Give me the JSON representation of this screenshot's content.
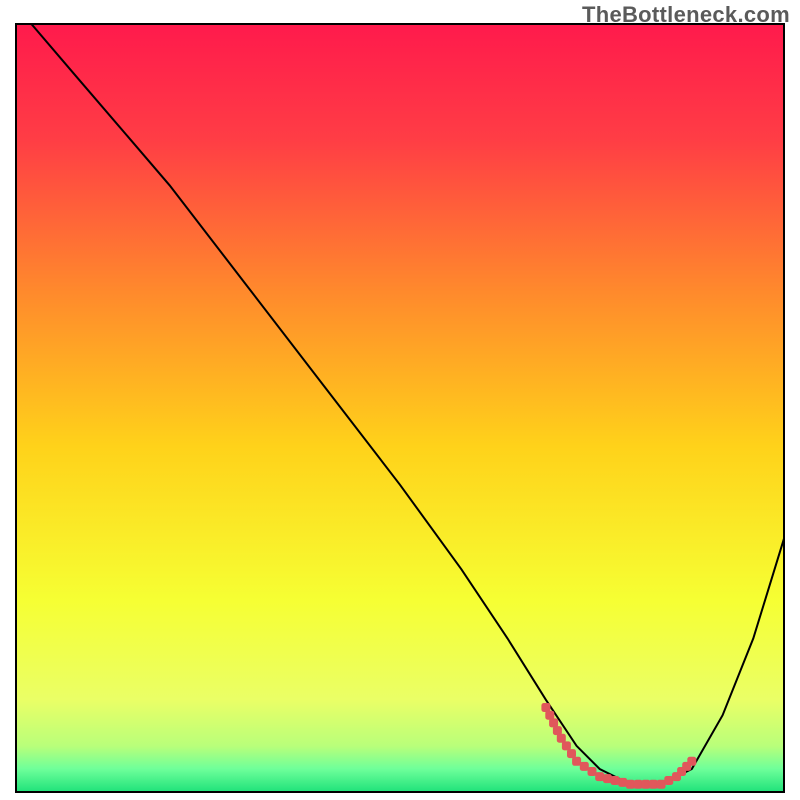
{
  "watermark": "TheBottleneck.com",
  "chart_data": {
    "type": "line",
    "title": "",
    "xlabel": "",
    "ylabel": "",
    "xlim": [
      0,
      100
    ],
    "ylim": [
      0,
      100
    ],
    "grid": false,
    "legend": false,
    "background_gradient": {
      "direction": "vertical",
      "stops": [
        {
          "pos": 0.0,
          "color": "#ff1a4c"
        },
        {
          "pos": 0.15,
          "color": "#ff3d45"
        },
        {
          "pos": 0.35,
          "color": "#ff8a2c"
        },
        {
          "pos": 0.55,
          "color": "#ffd21a"
        },
        {
          "pos": 0.75,
          "color": "#f6ff33"
        },
        {
          "pos": 0.88,
          "color": "#eaff66"
        },
        {
          "pos": 0.94,
          "color": "#b9ff7a"
        },
        {
          "pos": 0.97,
          "color": "#6eff9a"
        },
        {
          "pos": 1.0,
          "color": "#1fe27a"
        }
      ]
    },
    "series": [
      {
        "name": "bottleneck-curve",
        "color": "#000000",
        "x": [
          2,
          8,
          14,
          20,
          30,
          40,
          50,
          58,
          64,
          69,
          73,
          76,
          80,
          84,
          88,
          92,
          96,
          100
        ],
        "y": [
          100,
          93,
          86,
          79,
          66,
          53,
          40,
          29,
          20,
          12,
          6,
          3,
          1,
          1,
          3,
          10,
          20,
          33
        ]
      },
      {
        "name": "optimal-zone-marker",
        "color": "#e0575b",
        "style": "dotted-thick",
        "x": [
          69,
          71,
          73,
          76,
          80,
          84,
          86,
          88
        ],
        "y": [
          11,
          7,
          4,
          2,
          1,
          1,
          2,
          4
        ]
      }
    ],
    "optimal_range_x": [
      69,
      88
    ],
    "frame": {
      "x": 2,
      "y": 3,
      "w": 96,
      "h": 96,
      "stroke": "#000000"
    }
  }
}
